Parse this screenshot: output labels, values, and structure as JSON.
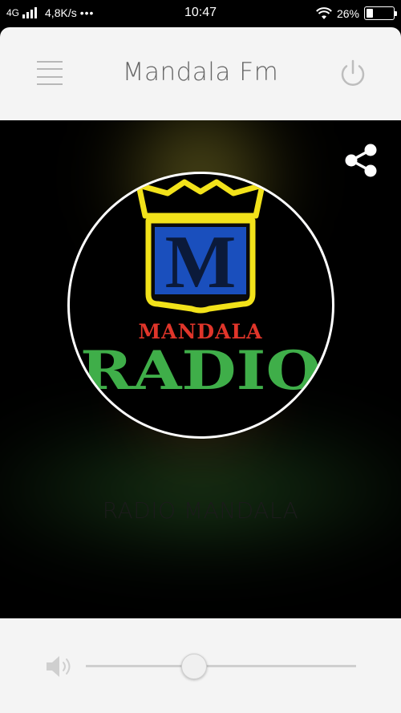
{
  "status_bar": {
    "network": "4G",
    "speed": "4,8K/s",
    "more_indicator": "•••",
    "time": "10:47",
    "battery_percent": "26%",
    "battery_level": 0.26
  },
  "app_bar": {
    "title": "Mandala Fm",
    "menu_icon": "hamburger-menu-icon",
    "power_icon": "power-icon"
  },
  "player": {
    "share_icon": "share-icon",
    "logo": {
      "letter": "M",
      "text_top": "MANDALA",
      "text_bottom": "RADIO",
      "colors": {
        "crest": "#f2e21a",
        "letter": "#1a4fbd",
        "text_top": "#e0352a",
        "text_bottom": "#3fae49"
      }
    },
    "station_name": "RADIO MANDALA"
  },
  "volume": {
    "speaker_icon": "speaker-icon",
    "level": 0.4
  }
}
